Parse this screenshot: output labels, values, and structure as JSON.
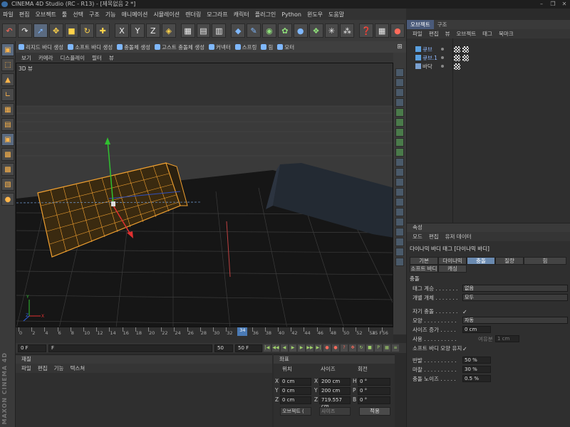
{
  "window": {
    "title": "CINEMA 4D Studio (RC - R13) - [제목없음 2 *]",
    "controls": [
      "–",
      "❐",
      "✕"
    ]
  },
  "menu": [
    "파일",
    "편집",
    "오브젝트",
    "툴",
    "선택",
    "구조",
    "기능",
    "애니메이션",
    "시뮬레이션",
    "렌더링",
    "모그라프",
    "캐릭터",
    "플러그인",
    "Python",
    "윈도우",
    "도움말"
  ],
  "main_toolbar": {
    "icons": [
      "undo-icon",
      "redo-icon",
      "live-select-icon",
      "move-icon",
      "scale-icon",
      "rotate-icon",
      "move-axis-icon",
      "x-axis-icon",
      "y-axis-icon",
      "z-axis-icon",
      "world-coords-icon",
      "render-view-icon",
      "render-picture-icon",
      "render-settings-icon",
      "cube-icon",
      "pen-icon",
      "subdivision-icon",
      "array-icon",
      "deformer-icon",
      "scene-icon",
      "particle-icon",
      "light-icon",
      "camera-icon"
    ],
    "axis_labels": [
      "X",
      "Y",
      "Z"
    ]
  },
  "viewport_toolbar": [
    "리지드 바디 생성",
    "소프트 바디 생성",
    "충돌체 생성",
    "고스트 충돌체 생성",
    "커넥터",
    "스프링",
    "힘",
    "모터"
  ],
  "viewport_menu": [
    "보기",
    "카메라",
    "디스플레이",
    "필터",
    "뷰"
  ],
  "viewport": {
    "label": "3D 뷰"
  },
  "timeline": {
    "ticks": [
      "0",
      "2",
      "4",
      "6",
      "8",
      "10",
      "12",
      "14",
      "16",
      "18",
      "20",
      "22",
      "24",
      "26",
      "28",
      "30",
      "32",
      "34",
      "36",
      "38",
      "40",
      "42",
      "44",
      "46",
      "48",
      "50",
      "52",
      "54",
      "56"
    ],
    "current_frame": "34",
    "end_label": "35 F"
  },
  "transport": {
    "start": "0 F",
    "field": "F",
    "end_field": "50",
    "end": "50 F"
  },
  "materials": {
    "title": "재질",
    "menu": [
      "파일",
      "편집",
      "기능",
      "텍스쳐"
    ]
  },
  "coordinates": {
    "title": "좌표",
    "headers": [
      "위치",
      "사이즈",
      "회전"
    ],
    "rows": [
      {
        "axis": "X",
        "pos": "0 cm",
        "size_axis": "X",
        "size": "200 cm",
        "rot_axis": "H",
        "rot": "0 °"
      },
      {
        "axis": "Y",
        "pos": "0 cm",
        "size_axis": "Y",
        "size": "200 cm",
        "rot_axis": "P",
        "rot": "0 °"
      },
      {
        "axis": "Z",
        "pos": "0 cm",
        "size_axis": "Z",
        "size": "719.557 cm",
        "rot_axis": "B",
        "rot": "0 °"
      }
    ],
    "mode": "오브젝트 (",
    "size_mode": "사이즈",
    "apply": "적용"
  },
  "object_manager": {
    "tabs": [
      "오브젝트",
      "구조"
    ],
    "menu": [
      "파일",
      "편집",
      "뷰",
      "오브젝트",
      "태그",
      "북마크"
    ],
    "objects": [
      {
        "name": "큐브"
      },
      {
        "name": "큐브.1"
      },
      {
        "name": "바닥"
      }
    ]
  },
  "attribute_manager": {
    "title": "속성",
    "menu": [
      "모드",
      "편집",
      "유저 데이터"
    ],
    "header": "다이나믹 바디 태그 [다이나믹 바디]",
    "tabs": [
      "기본",
      "다이나믹",
      "충돌",
      "질량",
      "힘",
      "소프트 바디",
      "캐싱"
    ],
    "section": "충돌",
    "fields": [
      {
        "label": "태그 계승 . . . . . . .",
        "value": "없음"
      },
      {
        "label": "개별 개체 . . . . . . .",
        "value": "모두"
      },
      {
        "label": "자기 충돌 . . . . . . .",
        "check": "✓"
      },
      {
        "label": "모양 . . . . . . . . . .",
        "value": "자동"
      },
      {
        "label": "사이즈 증가 . . . . .",
        "value": "0 cm"
      },
      {
        "label": "사용 . . . . . . . . . .",
        "check": "",
        "extra_label": "여유분",
        "extra": "1 cm"
      },
      {
        "label": "소프트 바디 모양 유지",
        "check": "✓"
      },
      {
        "label": "반발 . . . . . . . . . .",
        "value": "50 %"
      },
      {
        "label": "마찰 . . . . . . . . . .",
        "value": "30 %"
      },
      {
        "label": "충돌 노이즈 . . . . .",
        "value": "0.5 %"
      }
    ]
  },
  "colors": {
    "accent": "#4a7ab5",
    "cube_wire": "#f0a030",
    "axis_x": "#e03030",
    "axis_y": "#30c030",
    "axis_z": "#3060e0"
  }
}
